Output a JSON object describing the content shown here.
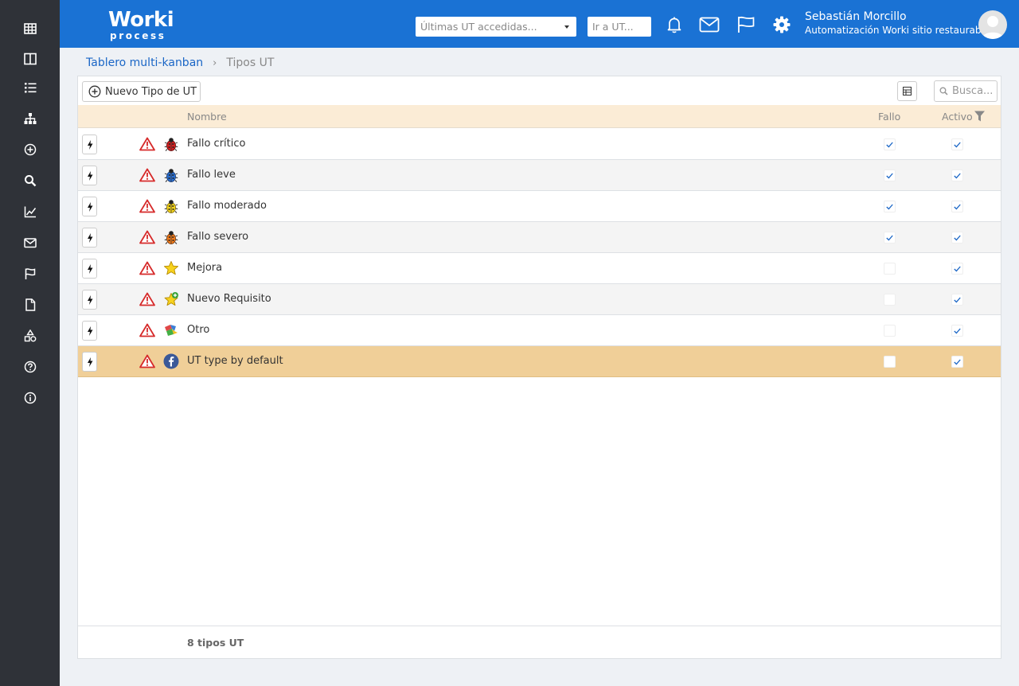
{
  "sidebar": {
    "items": [
      {
        "icon": "grid-icon"
      },
      {
        "icon": "columns-icon"
      },
      {
        "icon": "list-icon"
      },
      {
        "icon": "hierarchy-icon"
      },
      {
        "icon": "plus-circle-icon"
      },
      {
        "icon": "search-icon"
      },
      {
        "icon": "chart-line-icon"
      },
      {
        "icon": "envelope-icon"
      },
      {
        "icon": "flag-icon"
      },
      {
        "icon": "document-icon"
      },
      {
        "icon": "shapes-icon"
      },
      {
        "icon": "help-circle-icon"
      },
      {
        "icon": "info-circle-icon"
      }
    ]
  },
  "header": {
    "logo_line1": "Worki",
    "logo_line2": "process",
    "recent_placeholder": "Últimas UT accedidas...",
    "goto_placeholder": "Ir a UT...",
    "user_name": "Sebastián Morcillo",
    "user_site": "Automatización Worki sitio restaurable",
    "brand_color": "#1a72d4"
  },
  "breadcrumb": {
    "parent": "Tablero multi-kanban",
    "current": "Tipos UT"
  },
  "toolbar": {
    "new_button": "Nuevo Tipo de UT",
    "search_placeholder": "Busca..."
  },
  "table": {
    "columns": {
      "name": "Nombre",
      "fallo": "Fallo",
      "activo": "Activo"
    },
    "rows": [
      {
        "name": "Fallo crítico",
        "icon": "red-bug-icon",
        "fallo": true,
        "activo": true,
        "selected": false
      },
      {
        "name": "Fallo leve",
        "icon": "blue-bug-icon",
        "fallo": true,
        "activo": true,
        "selected": false
      },
      {
        "name": "Fallo moderado",
        "icon": "yellow-bug-icon",
        "fallo": true,
        "activo": true,
        "selected": false
      },
      {
        "name": "Fallo severo",
        "icon": "orange-bug-icon",
        "fallo": true,
        "activo": true,
        "selected": false
      },
      {
        "name": "Mejora",
        "icon": "star-icon",
        "fallo": false,
        "activo": true,
        "selected": false
      },
      {
        "name": "Nuevo Requisito",
        "icon": "star-plus-icon",
        "fallo": false,
        "activo": true,
        "selected": false
      },
      {
        "name": "Otro",
        "icon": "puzzle-icon",
        "fallo": false,
        "activo": true,
        "selected": false
      },
      {
        "name": "UT type by default",
        "icon": "facebook-icon",
        "fallo": false,
        "activo": true,
        "selected": true
      }
    ],
    "footer": "8 tipos UT"
  },
  "colors": {
    "header_row": "#fbecd6",
    "selected_row": "#f0cf98",
    "sidebar": "#2f3238",
    "check": "#1a66c6"
  }
}
